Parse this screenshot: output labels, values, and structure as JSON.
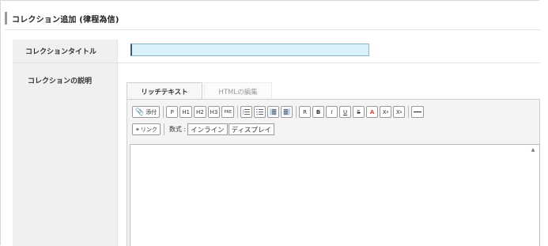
{
  "header": {
    "title": "コレクション追加 (律程為信)"
  },
  "form": {
    "title_label": "コレクションタイトル",
    "title_value": "",
    "description_label": "コレクションの説明"
  },
  "editor": {
    "tabs": [
      {
        "label": "リッチテキスト",
        "active": true
      },
      {
        "label": "HTMLの編集",
        "active": false
      }
    ],
    "toolbar": {
      "attach": "添付",
      "p": "P",
      "h1": "H1",
      "h2": "H2",
      "h3": "H3",
      "pre": "PRE",
      "r": "R",
      "b": "B",
      "i": "I",
      "u": "U",
      "s": "S",
      "a": "A",
      "sup": "X",
      "sub": "X",
      "link": "リンク",
      "math_label": "数式 :",
      "math_inline": "インライン",
      "math_display": "ディスプレイ"
    },
    "content": ""
  },
  "colors": {
    "title_input_bg": "#d9f1f9",
    "accent": "#9a9a9a",
    "red_icon": "#d84a3a"
  }
}
